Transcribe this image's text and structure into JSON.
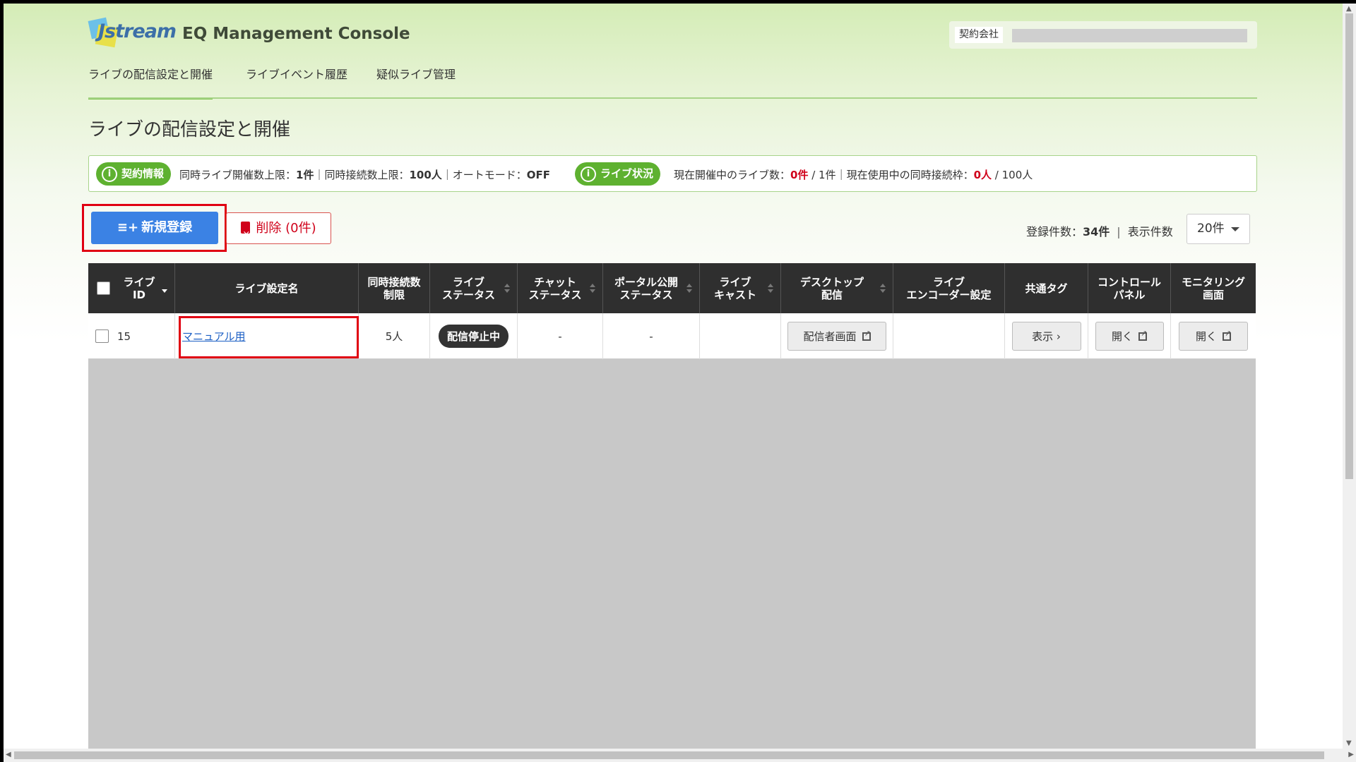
{
  "header": {
    "logo_text": "Jstream",
    "app_title": "EQ Management Console",
    "company_label": "契約会社"
  },
  "nav": {
    "items": [
      {
        "label": "ライブの配信設定と開催",
        "active": true
      },
      {
        "label": "ライブイベント履歴",
        "active": false
      },
      {
        "label": "疑似ライブ管理",
        "active": false
      }
    ]
  },
  "page_title": "ライブの配信設定と開催",
  "info_bar": {
    "contract_pill": "契約情報",
    "contract_text_1": "同時ライブ開催数上限：",
    "contract_value_1": "1件",
    "contract_text_2": "｜同時接続数上限：",
    "contract_value_2": "100人",
    "contract_text_3": "｜オートモード：",
    "contract_value_3": "OFF",
    "status_pill": "ライブ状況",
    "status_text_1": "現在開催中のライブ数：",
    "status_value_1": "0件",
    "status_text_2": " / 1件｜現在使用中の同時接続枠：",
    "status_value_2": "0人",
    "status_text_3": " / 100人"
  },
  "actions": {
    "new_label": "新規登録",
    "delete_label": "削除 (0件)",
    "registered_label": "登録件数：",
    "registered_count": "34件",
    "display_label": "表示件数",
    "per_page": "20件"
  },
  "table": {
    "headers": [
      "ライブ\nID",
      "ライブ設定名",
      "同時接続数\n制限",
      "ライブ\nステータス",
      "チャット\nステータス",
      "ポータル公開\nステータス",
      "ライブ\nキャスト",
      "デスクトップ\n配信",
      "ライブ\nエンコーダー設定",
      "共通タグ",
      "コントロール\nパネル",
      "モニタリング\n画面"
    ],
    "rows": [
      {
        "id": "15",
        "name": "マニュアル用",
        "limit": "5人",
        "live_status": "配信停止中",
        "chat_status": "-",
        "portal_status": "-",
        "live_cast": "",
        "desktop_button": "配信者画面",
        "encoder": "",
        "tag_button": "表示 ›",
        "control_button": "開く",
        "monitor_button": "開く"
      }
    ]
  },
  "colors": {
    "accent_green": "#5eb130",
    "primary_blue": "#3b82e4",
    "danger_red": "#d0021b",
    "highlight_red": "#e00012",
    "table_header": "#2f2f2f"
  }
}
